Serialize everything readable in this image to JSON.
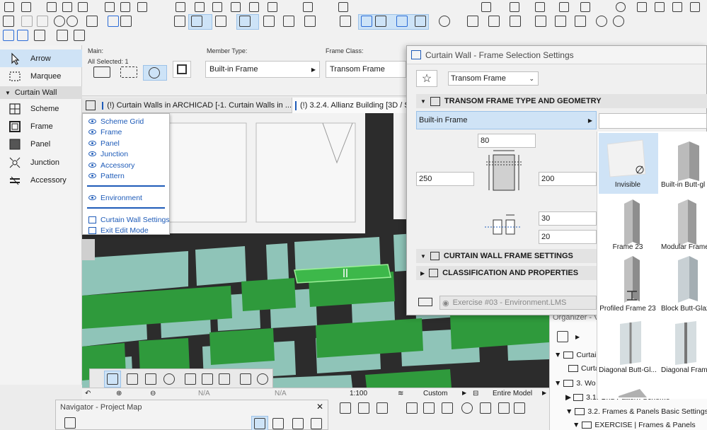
{
  "toolbox": {
    "tools": [
      {
        "label": "Arrow"
      },
      {
        "label": "Marquee"
      }
    ],
    "group_label": "Curtain Wall",
    "cw_tools": [
      {
        "label": "Scheme"
      },
      {
        "label": "Frame"
      },
      {
        "label": "Panel"
      },
      {
        "label": "Junction"
      },
      {
        "label": "Accessory"
      }
    ]
  },
  "infobox": {
    "main_label": "Main:",
    "selected_label": "All Selected: 1",
    "member_type_label": "Member Type:",
    "member_type_value": "Built-in Frame",
    "frame_class_label": "Frame Class:",
    "frame_class_value": "Transom Frame"
  },
  "tabs": [
    {
      "label": "(!) Curtain Walls in ARCHICAD [-1. Curtain Walls in ..."
    },
    {
      "label": "(!) 3.2.4. Allianz Building [3D / Se"
    }
  ],
  "flyout": {
    "items": [
      "Scheme Grid",
      "Frame",
      "Panel",
      "Junction",
      "Accessory",
      "Pattern"
    ],
    "environment": "Environment",
    "settings": "Curtain Wall Settings",
    "exit": "Exit Edit Mode"
  },
  "status": {
    "na1": "N/A",
    "na2": "N/A",
    "scale": "1:100",
    "custom": "Custom",
    "model": "Entire Model"
  },
  "navigator": {
    "title": "Navigator - Project Map"
  },
  "organizer": {
    "title": "Organizer - V",
    "items": [
      "Curtain",
      "Curta",
      "3. Wo",
      "3.1. Grid Pattern Scheme",
      "3.2. Frames & Panels Basic Settings",
      "EXERCISE | Frames & Panels"
    ]
  },
  "dialog": {
    "title": "Curtain Wall - Frame Selection Settings",
    "favorite_value": "Transom Frame",
    "section1": "TRANSOM FRAME TYPE AND GEOMETRY",
    "frame_type": "Built-in Frame",
    "dim_top": "80",
    "dim_left": "250",
    "dim_right": "200",
    "dim_offset1": "30",
    "dim_offset2": "20",
    "section2": "CURTAIN WALL FRAME SETTINGS",
    "section3": "CLASSIFICATION AND PROPERTIES",
    "env_label": "Exercise #03 - Environment.LMS"
  },
  "gallery": {
    "items": [
      "Invisible",
      "Built-in Butt-gl",
      "Frame 23",
      "Modular Frame",
      "Profiled Frame 23",
      "Block Butt-Glaz",
      "Diagonal Butt-Gl...",
      "Diagonal Frame"
    ]
  },
  "colors": {
    "selection_bg": "#cfe3f6",
    "accent_blue": "#1e5bb8",
    "glass": "#8fc4b8",
    "green_panel": "#2f9a3c",
    "frame_dark": "#2a2a2a"
  }
}
